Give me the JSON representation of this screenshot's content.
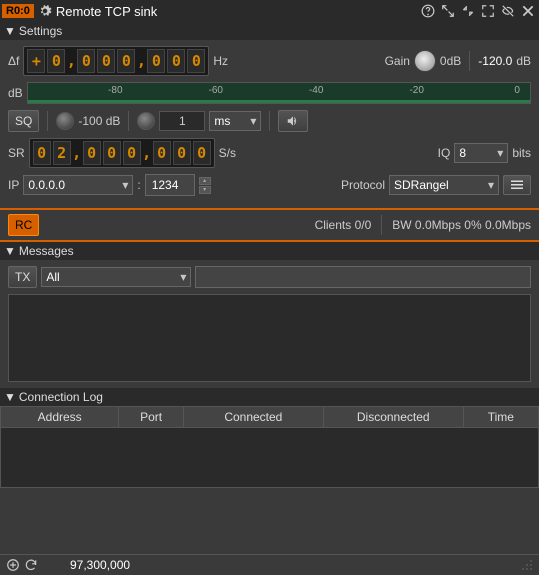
{
  "titlebar": {
    "index": "R0:0",
    "title": "Remote TCP sink"
  },
  "sections": {
    "settings": "Settings",
    "messages": "Messages",
    "log": "Connection Log"
  },
  "freq": {
    "label": "Δf",
    "sign": "+",
    "d1": "0",
    "d2": "0",
    "d3": "0",
    "d4": "0",
    "d5": "0",
    "d6": "0",
    "d7": "0",
    "unit": "Hz"
  },
  "gain": {
    "label": "Gain",
    "value": "0dB"
  },
  "power": {
    "value": "-120.0",
    "unit": "dB"
  },
  "scale": {
    "label": "dB",
    "t1": "-80",
    "t2": "-60",
    "t3": "-40",
    "t4": "-20",
    "t5": "0"
  },
  "squelch": {
    "btn": "SQ",
    "level": "-100 dB",
    "delay": "1",
    "delay_unit": "ms"
  },
  "sr": {
    "label": "SR",
    "d1": "0",
    "d2": "2",
    "d3": "0",
    "d4": "0",
    "d5": "0",
    "d6": "0",
    "d7": "0",
    "d8": "0",
    "unit": "S/s"
  },
  "iq": {
    "label": "IQ",
    "value": "8",
    "unit": "bits"
  },
  "ip": {
    "label": "IP",
    "addr": "0.0.0.0",
    "sep": ":",
    "port": "1234"
  },
  "protocol": {
    "label": "Protocol",
    "value": "SDRangel"
  },
  "rc": {
    "btn": "RC"
  },
  "clients": {
    "text": "Clients 0/0"
  },
  "bw": {
    "text": "BW 0.0Mbps 0% 0.0Mbps"
  },
  "msg": {
    "tx": "TX",
    "filter": "All"
  },
  "log_cols": {
    "addr": "Address",
    "port": "Port",
    "conn": "Connected",
    "disc": "Disconnected",
    "time": "Time"
  },
  "footer": {
    "freq": "97,300,000"
  }
}
